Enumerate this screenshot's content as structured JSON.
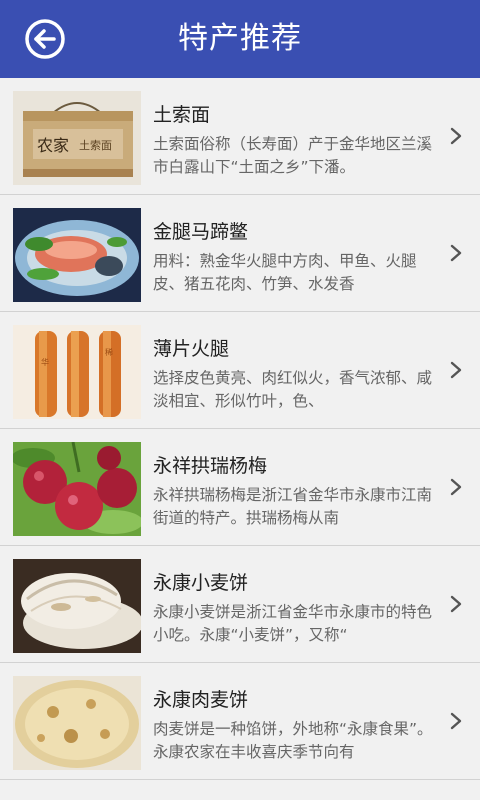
{
  "header": {
    "title": "特产推荐",
    "bg_color": "#3a4fb2",
    "back_icon": "circle-arrow-left-icon"
  },
  "items": [
    {
      "name": "土索面",
      "desc": "土索面俗称（长寿面）产于金华地区兰溪市白露山下“土面之乡”下潘。",
      "image": "gift-box-photo"
    },
    {
      "name": "金腿马蹄鳖",
      "desc": "用料：熟金华火腿中方肉、甲鱼、火腿皮、猪五花肉、竹笋、水发香",
      "image": "dish-photo"
    },
    {
      "name": "薄片火腿",
      "desc": "选择皮色黄亮、肉红似火，香气浓郁、咸淡相宜、形似竹叶，色、",
      "image": "ham-photo"
    },
    {
      "name": "永祥拱瑞杨梅",
      "desc": "永祥拱瑞杨梅是浙江省金华市永康市江南街道的特产。拱瑞杨梅从南",
      "image": "bayberry-photo"
    },
    {
      "name": "永康小麦饼",
      "desc": "永康小麦饼是浙江省金华市永康市的特色小吃。永康“小麦饼”，又称“",
      "image": "flatbread-photo"
    },
    {
      "name": "永康肉麦饼",
      "desc": "肉麦饼是一种馅饼，外地称“永康食果”。永康农家在丰收喜庆季节向有",
      "image": "meat-pie-photo"
    }
  ]
}
